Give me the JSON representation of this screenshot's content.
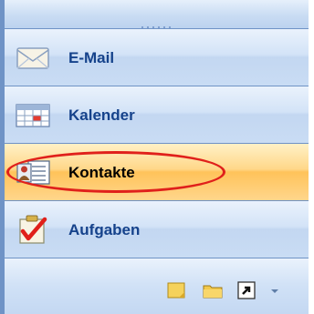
{
  "nav": {
    "items": [
      {
        "label": "E-Mail",
        "icon": "mail-envelope-icon",
        "active": false
      },
      {
        "label": "Kalender",
        "icon": "calendar-icon",
        "active": false
      },
      {
        "label": "Kontakte",
        "icon": "contacts-card-icon",
        "active": true
      },
      {
        "label": "Aufgaben",
        "icon": "tasks-checkmark-icon",
        "active": false
      }
    ]
  },
  "bottom_bar": {
    "icons": [
      "notes-icon",
      "folder-icon",
      "shortcuts-icon",
      "configure-buttons-chevron-icon"
    ]
  },
  "colors": {
    "nav_text": "#15428b",
    "active_bg": "#ffc35a",
    "highlight": "#e0201b",
    "border": "#6f93c6"
  }
}
